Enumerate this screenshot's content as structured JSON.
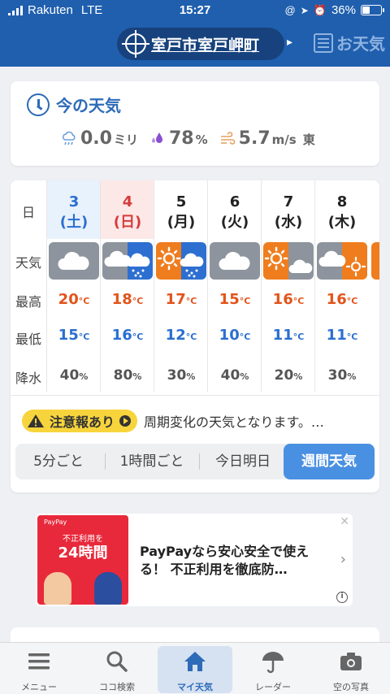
{
  "status": {
    "carrier": "Rakuten",
    "network": "LTE",
    "time": "15:27",
    "battery": "36%"
  },
  "header": {
    "location": "室戸市室戸岬町",
    "news_label": "お天気"
  },
  "now": {
    "title": "今の天気",
    "precip_value": "0.0",
    "precip_unit": "ミリ",
    "humidity_value": "78",
    "humidity_unit": "%",
    "wind_value": "5.7",
    "wind_unit": "m/s",
    "wind_dir": "東"
  },
  "weekly": {
    "row_labels": {
      "day": "日",
      "weather": "天気",
      "high": "最高",
      "low": "最低",
      "rain": "降水"
    },
    "days": [
      {
        "date": "3",
        "dow": "(土)",
        "high": "20",
        "low": "15",
        "rain": "40",
        "weather": "cloudy"
      },
      {
        "date": "4",
        "dow": "(日)",
        "high": "18",
        "low": "16",
        "rain": "80",
        "weather": "cloudy-then-rain"
      },
      {
        "date": "5",
        "dow": "(月)",
        "high": "17",
        "low": "12",
        "rain": "30",
        "weather": "sunny-then-rain"
      },
      {
        "date": "6",
        "dow": "(火)",
        "high": "15",
        "low": "10",
        "rain": "40",
        "weather": "cloudy"
      },
      {
        "date": "7",
        "dow": "(水)",
        "high": "16",
        "low": "11",
        "rain": "20",
        "weather": "sunny-then-cloudy"
      },
      {
        "date": "8",
        "dow": "(木)",
        "high": "16",
        "low": "11",
        "rain": "30",
        "weather": "cloudy-then-sunny"
      }
    ],
    "temp_unit": "°C",
    "rain_unit": "%",
    "alert_badge": "注意報あり",
    "alert_text": "周期変化の天気となります。…",
    "tabs": [
      "5分ごと",
      "1時間ごと",
      "今日明日",
      "週間天気"
    ],
    "active_tab": "週間天気"
  },
  "ad": {
    "brand": "PayPay",
    "image_line1": "不正利用を",
    "image_line2": "24時間",
    "text": "PayPayなら安心安全で使える！ 不正利用を徹底防…",
    "info": "i"
  },
  "tabbar": [
    {
      "label": "メニュー",
      "icon": "menu-icon"
    },
    {
      "label": "ココ検索",
      "icon": "search-icon"
    },
    {
      "label": "マイ天気",
      "icon": "home-icon"
    },
    {
      "label": "レーダー",
      "icon": "radar-umbrella-icon"
    },
    {
      "label": "空の写真",
      "icon": "camera-icon"
    }
  ],
  "colors": {
    "header_bg": "#1f5fae",
    "accent": "#2e6bb8",
    "high_temp": "#e2541b",
    "low_temp": "#2a6fcf",
    "alert": "#f7d43c",
    "active_tab": "#4a90e2"
  }
}
